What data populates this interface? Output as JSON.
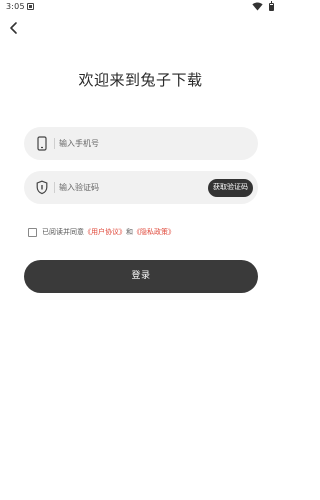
{
  "status_bar": {
    "time": "3:05"
  },
  "header": {
    "title": "欢迎来到兔子下载"
  },
  "phone_field": {
    "placeholder": "输入手机号"
  },
  "code_field": {
    "placeholder": "输入验证码",
    "get_code_label": "获取验证码"
  },
  "agreement": {
    "prefix": "已阅读并同意",
    "user_agreement": "《用户协议》",
    "conjunction": "和",
    "privacy_policy": "《隐私政策》",
    "checked": false
  },
  "login_button": {
    "label": "登录"
  },
  "colors": {
    "link": "#e0483a",
    "button": "#3a3a3a",
    "field_bg": "#f1f1f1"
  }
}
